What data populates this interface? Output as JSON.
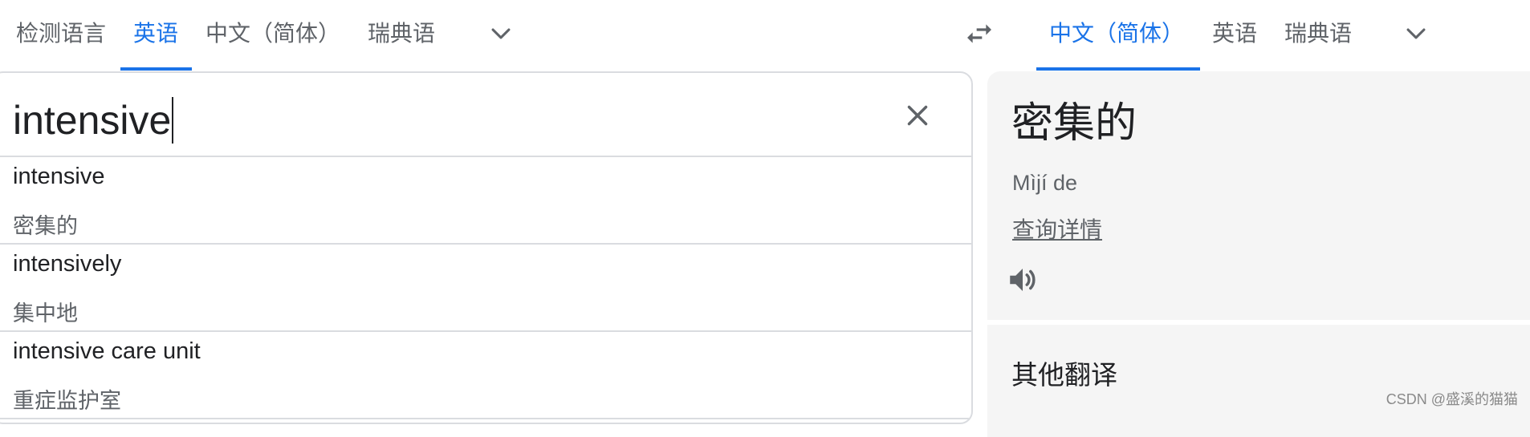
{
  "source_languages": [
    {
      "label": "检测语言",
      "active": false
    },
    {
      "label": "英语",
      "active": true
    },
    {
      "label": "中文（简体）",
      "active": false
    },
    {
      "label": "瑞典语",
      "active": false
    }
  ],
  "target_languages": [
    {
      "label": "中文（简体）",
      "active": true
    },
    {
      "label": "英语",
      "active": false
    },
    {
      "label": "瑞典语",
      "active": false
    }
  ],
  "icons": {
    "source_more": "chevron-down-icon",
    "swap": "swap-arrows-icon",
    "target_more": "chevron-down-icon",
    "clear": "close-icon",
    "listen": "speaker-icon"
  },
  "source": {
    "input_value": "intensive"
  },
  "suggestions": [
    {
      "word": "intensive",
      "translation": "密集的"
    },
    {
      "word": "intensively",
      "translation": "集中地"
    },
    {
      "word": "intensive care unit",
      "translation": "重症监护室"
    }
  ],
  "target": {
    "translation": "密集的",
    "romanization": "Mìjí de",
    "details_link": "查询详情"
  },
  "other_translations": {
    "title": "其他翻译"
  },
  "watermark": "CSDN @盛溪的猫猫",
  "colors": {
    "accent": "#1a73e8",
    "text_primary": "#202124",
    "text_secondary": "#5f6368",
    "border": "#dadce0",
    "target_background": "#f5f5f5"
  }
}
